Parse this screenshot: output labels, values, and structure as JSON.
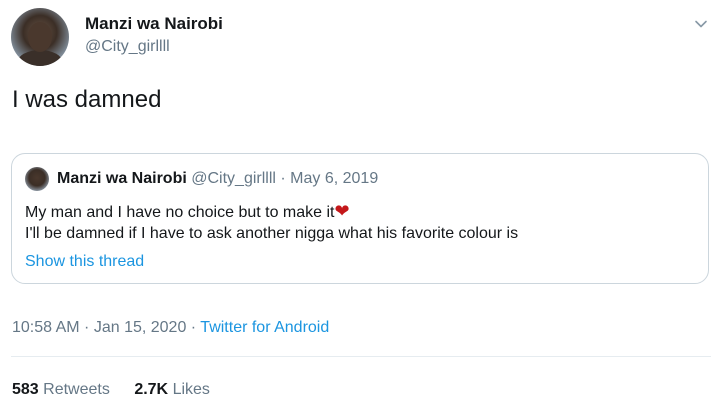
{
  "author": {
    "display_name": "Manzi wa Nairobi",
    "handle": "@City_girllll"
  },
  "tweet": {
    "text": "I was damned",
    "time": "10:58 AM",
    "date": "Jan 15, 2020",
    "source": "Twitter for Android"
  },
  "quoted": {
    "display_name": "Manzi wa Nairobi",
    "handle": "@City_girllll",
    "date": "May 6, 2019",
    "line1": "My man and I have no choice but to make it",
    "line2": "I'll be damned if I have to ask another nigga what his favorite colour is",
    "show_thread": "Show this thread"
  },
  "stats": {
    "retweets_count": "583",
    "retweets_label": "Retweets",
    "likes_count": "2.7K",
    "likes_label": "Likes"
  },
  "separators": {
    "dot": " · "
  },
  "icons": {
    "caret": "chevron-down-icon",
    "heart": "red-heart-emoji"
  },
  "colors": {
    "link": "#1b95e0",
    "muted": "#657786",
    "text": "#14171a",
    "border": "#ccd6dd",
    "heart": "#c4171a"
  }
}
